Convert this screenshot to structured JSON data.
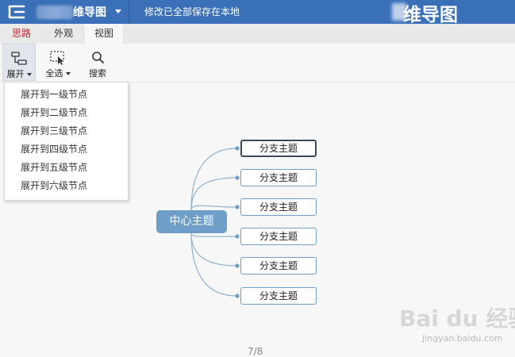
{
  "titlebar": {
    "app_name": "维导图",
    "save_status": "修改已全部保存在本地",
    "brand_text": "维导图"
  },
  "tabs": [
    {
      "label": "思路"
    },
    {
      "label": "外观"
    },
    {
      "label": "视图"
    }
  ],
  "toolbar": {
    "expand_label": "展开",
    "select_all_label": "全选",
    "search_label": "搜索"
  },
  "dropdown": {
    "items": [
      {
        "label": "展开到一级节点"
      },
      {
        "label": "展开到二级节点"
      },
      {
        "label": "展开到三级节点"
      },
      {
        "label": "展开到四级节点"
      },
      {
        "label": "展开到五级节点"
      },
      {
        "label": "展开到六级节点"
      }
    ]
  },
  "mindmap": {
    "central": "中心主题",
    "branches": [
      {
        "label": "分支主题",
        "selected": true
      },
      {
        "label": "分支主题"
      },
      {
        "label": "分支主题"
      },
      {
        "label": "分支主题"
      },
      {
        "label": "分支主题"
      },
      {
        "label": "分支主题"
      }
    ]
  },
  "footer": {
    "page_indicator": "7/8"
  },
  "watermark": {
    "main": "Bai du 经验",
    "sub": "jingyan.baidu.com"
  },
  "colors": {
    "titlebar": "#3a70b8",
    "central_node": "#6f9ec8",
    "branch_border": "#6f9ec8",
    "active_tab_text": "#c0272d"
  },
  "icons": [
    "app-logo-icon",
    "expand-tree-icon",
    "select-all-icon",
    "search-icon"
  ]
}
